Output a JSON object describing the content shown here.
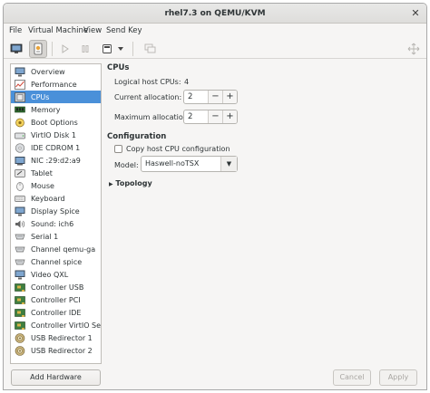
{
  "window": {
    "title": "rhel7.3 on QEMU/KVM"
  },
  "menubar": {
    "items": [
      "File",
      "Virtual Machine",
      "View",
      "Send Key"
    ]
  },
  "toolbar": {
    "buttons": [
      "console-icon",
      "details-icon",
      "run-icon",
      "pause-icon",
      "shutdown-icon",
      "shutdown-menu-icon",
      "snapshot-icon",
      "fullscreen-icon"
    ],
    "active": "details-icon"
  },
  "sidebar": {
    "selected": "CPUs",
    "items": [
      {
        "label": "Overview",
        "icon": "monitor-icon"
      },
      {
        "label": "Performance",
        "icon": "performance-icon"
      },
      {
        "label": "CPUs",
        "icon": "cpu-icon"
      },
      {
        "label": "Memory",
        "icon": "memory-icon"
      },
      {
        "label": "Boot Options",
        "icon": "boot-icon"
      },
      {
        "label": "VirtIO Disk 1",
        "icon": "disk-icon"
      },
      {
        "label": "IDE CDROM 1",
        "icon": "cdrom-icon"
      },
      {
        "label": "NIC :29:d2:a9",
        "icon": "nic-icon"
      },
      {
        "label": "Tablet",
        "icon": "tablet-icon"
      },
      {
        "label": "Mouse",
        "icon": "mouse-icon"
      },
      {
        "label": "Keyboard",
        "icon": "keyboard-icon"
      },
      {
        "label": "Display Spice",
        "icon": "display-icon"
      },
      {
        "label": "Sound: ich6",
        "icon": "sound-icon"
      },
      {
        "label": "Serial 1",
        "icon": "serial-icon"
      },
      {
        "label": "Channel qemu-ga",
        "icon": "channel-icon"
      },
      {
        "label": "Channel spice",
        "icon": "channel-icon"
      },
      {
        "label": "Video QXL",
        "icon": "video-icon"
      },
      {
        "label": "Controller USB",
        "icon": "controller-icon"
      },
      {
        "label": "Controller PCI",
        "icon": "controller-icon"
      },
      {
        "label": "Controller IDE",
        "icon": "controller-icon"
      },
      {
        "label": "Controller VirtIO Serial",
        "icon": "controller-icon"
      },
      {
        "label": "USB Redirector 1",
        "icon": "usb-redirector-icon"
      },
      {
        "label": "USB Redirector 2",
        "icon": "usb-redirector-icon"
      }
    ],
    "add_hardware": "Add Hardware"
  },
  "cpus": {
    "title": "CPUs",
    "logical_label": "Logical host CPUs:",
    "logical_value": "4",
    "current_label": "Current allocation:",
    "current_value": "2",
    "max_label": "Maximum allocation:",
    "max_value": "2",
    "minus": "−",
    "plus": "+"
  },
  "configuration": {
    "title": "Configuration",
    "copy_label": "Copy host CPU configuration",
    "copy_checked": false,
    "model_label": "Model:",
    "model_value": "Haswell-noTSX"
  },
  "topology": {
    "label": "Topology"
  },
  "footer": {
    "cancel": "Cancel",
    "apply": "Apply"
  },
  "colors": {
    "selection": "#4a90d9",
    "window_bg": "#f6f5f4"
  }
}
